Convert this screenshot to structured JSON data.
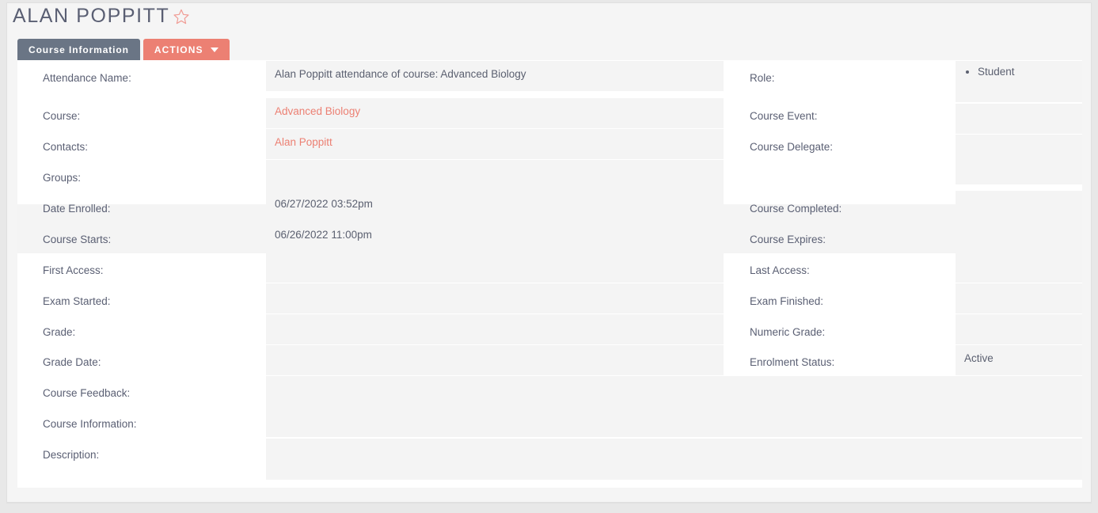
{
  "header": {
    "title": "ALAN POPPITT",
    "favorite_icon": "star-outline-icon"
  },
  "tabs": [
    {
      "label": "Course Information",
      "active": true
    },
    {
      "label": "ACTIONS",
      "dropdown": true
    }
  ],
  "colors": {
    "accent": "#ec8073",
    "tab_active": "#6a7585",
    "label_text": "#5a5f73",
    "cell_bg": "#f4f4f4",
    "panel_bg": "#ffffff",
    "page_bg": "#f5f5f5"
  },
  "fields": {
    "left": [
      {
        "label": "Attendance Name:",
        "value": "Alan Poppitt attendance of course: Advanced Biology",
        "type": "text"
      },
      {
        "label": "Course:",
        "value": "Advanced Biology",
        "type": "link"
      },
      {
        "label": "Contacts:",
        "value": "Alan Poppitt",
        "type": "link"
      },
      {
        "label": "Groups:",
        "value": "",
        "type": "text"
      },
      {
        "label": "Date Enrolled:",
        "value": "06/27/2022 03:52pm",
        "type": "text"
      },
      {
        "label": "Course Starts:",
        "value": "06/26/2022 11:00pm",
        "type": "text"
      },
      {
        "label": "First Access:",
        "value": "",
        "type": "text"
      },
      {
        "label": "Exam Started:",
        "value": "",
        "type": "text"
      },
      {
        "label": "Grade:",
        "value": "",
        "type": "text"
      },
      {
        "label": "Grade Date:",
        "value": "",
        "type": "text"
      }
    ],
    "right": [
      {
        "label": "Role:",
        "value": "Student",
        "type": "bullet"
      },
      {
        "label": "Course Event:",
        "value": "",
        "type": "text"
      },
      {
        "label": "Course Delegate:",
        "value": "",
        "type": "text"
      },
      {
        "label": "",
        "value": "",
        "type": "spacer"
      },
      {
        "label": "Course Completed:",
        "value": "",
        "type": "text"
      },
      {
        "label": "Course Expires:",
        "value": "",
        "type": "text"
      },
      {
        "label": "Last Access:",
        "value": "",
        "type": "text"
      },
      {
        "label": "Exam Finished:",
        "value": "",
        "type": "text"
      },
      {
        "label": "Numeric Grade:",
        "value": "",
        "type": "text"
      },
      {
        "label": "Enrolment Status:",
        "value": "Active",
        "type": "text"
      }
    ],
    "full": [
      {
        "label": "Course Feedback:",
        "value": "",
        "type": "text"
      },
      {
        "label": "Course Information:",
        "value": "",
        "type": "text"
      },
      {
        "label": "Description:",
        "value": "",
        "type": "text"
      }
    ]
  }
}
